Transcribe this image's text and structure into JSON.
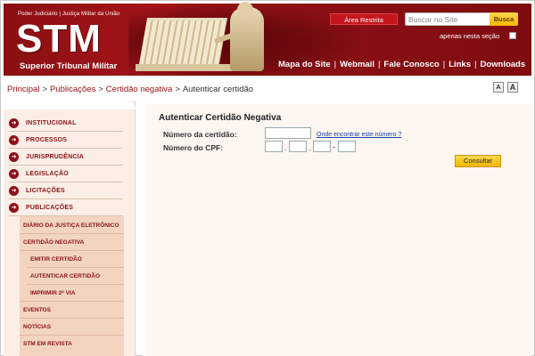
{
  "header": {
    "top_caption": "Poder Judiciário | Justiça Militar da União",
    "logo": "STM",
    "logo_subtitle": "Superior Tribunal Militar",
    "area_restrita": "Área Restrita",
    "search": {
      "placeholder": "Buscar no Site",
      "button": "Busca"
    },
    "apenas_label": "apenas nesta seção",
    "nav": [
      "Mapa do Site",
      "Webmail",
      "Fale Conosco",
      "Links",
      "Downloads"
    ]
  },
  "breadcrumb": {
    "items": [
      "Principal",
      "Publicações",
      "Certidão negativa",
      "Autenticar certidão"
    ],
    "separator": ">"
  },
  "font_controls": [
    "A",
    "A"
  ],
  "sidebar": {
    "items": [
      "INSTITUCIONAL",
      "PROCESSOS",
      "JURISPRUDÊNCIA",
      "LEGISLAÇÃO",
      "LICITAÇÕES",
      "PUBLICAÇÕES"
    ],
    "sub_items": [
      "DIÁRIO DA JUSTIÇA ELETRÔNICO",
      "CERTIDÃO NEGATIVA",
      "EMITIR CERTIDÃO",
      "AUTENTICAR CERTIDÃO",
      "IMPRIMIR 2ª VIA",
      "EVENTOS",
      "NOTÍCIAS",
      "STM EM REVISTA"
    ]
  },
  "form": {
    "title": "Autenticar Certidão Negativa",
    "certidao_label": "Número da certidão:",
    "where_link": "Onde encontrar este número ?",
    "cpf_label": "Número do CPF:",
    "cpf_sep": ".",
    "cpf_dash": "-",
    "submit": "Consultar"
  },
  "colors": {
    "brand_red": "#8d1116",
    "button_yellow": "#f5b800",
    "sidebar_bg": "#fbeee6"
  }
}
